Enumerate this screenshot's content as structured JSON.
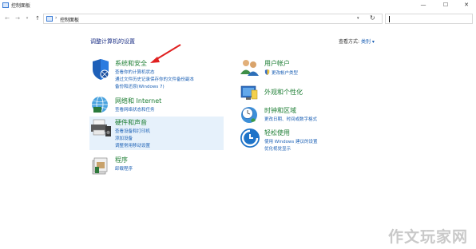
{
  "window": {
    "title": "控制面板",
    "minimize_label": "—",
    "maximize_label": "☐",
    "close_label": "✕"
  },
  "addressbar": {
    "back": "←",
    "forward": "→",
    "recent": "▾",
    "up": "↑",
    "separator": "›",
    "breadcrumb": "控制面板",
    "dropdown": "▾",
    "refresh": "↻",
    "search_value": "",
    "search_placeholder": ""
  },
  "main": {
    "heading": "调整计算机的设置",
    "view_by_label": "查看方式:",
    "view_by_value": "类别 ▾"
  },
  "categories_left": [
    {
      "title": "系统和安全",
      "icon": "shield-icon",
      "links": [
        "查看你的计算机状态",
        "通过文件历史记录保存你的文件备份副本",
        "备份和还原(Windows 7)"
      ]
    },
    {
      "title": "网络和 Internet",
      "icon": "network-globe-icon",
      "links": [
        "查看网络状态和任务"
      ]
    },
    {
      "title": "硬件和声音",
      "icon": "printer-speaker-icon",
      "links": [
        "查看设备和打印机",
        "添加设备",
        "调整常用移动设置"
      ]
    },
    {
      "title": "程序",
      "icon": "programs-box-icon",
      "links": [
        "卸载程序"
      ]
    }
  ],
  "categories_right": [
    {
      "title": "用户帐户",
      "icon": "users-icon",
      "links": [
        "更改帐户类型"
      ]
    },
    {
      "title": "外观和个性化",
      "icon": "appearance-icon",
      "links": []
    },
    {
      "title": "时钟和区域",
      "icon": "clock-globe-icon",
      "links": [
        "更改日期、时间或数字格式"
      ]
    },
    {
      "title": "轻松使用",
      "icon": "ease-of-access-icon",
      "links": [
        "使用 Windows 建议的设置",
        "优化视觉显示"
      ]
    }
  ],
  "watermark": "作文玩家网",
  "colors": {
    "category_title": "#1e7e34",
    "link": "#1a5fb4",
    "heading": "#1e3287",
    "annotation_arrow": "#e02020",
    "hover_background": "#e6f1fb"
  }
}
